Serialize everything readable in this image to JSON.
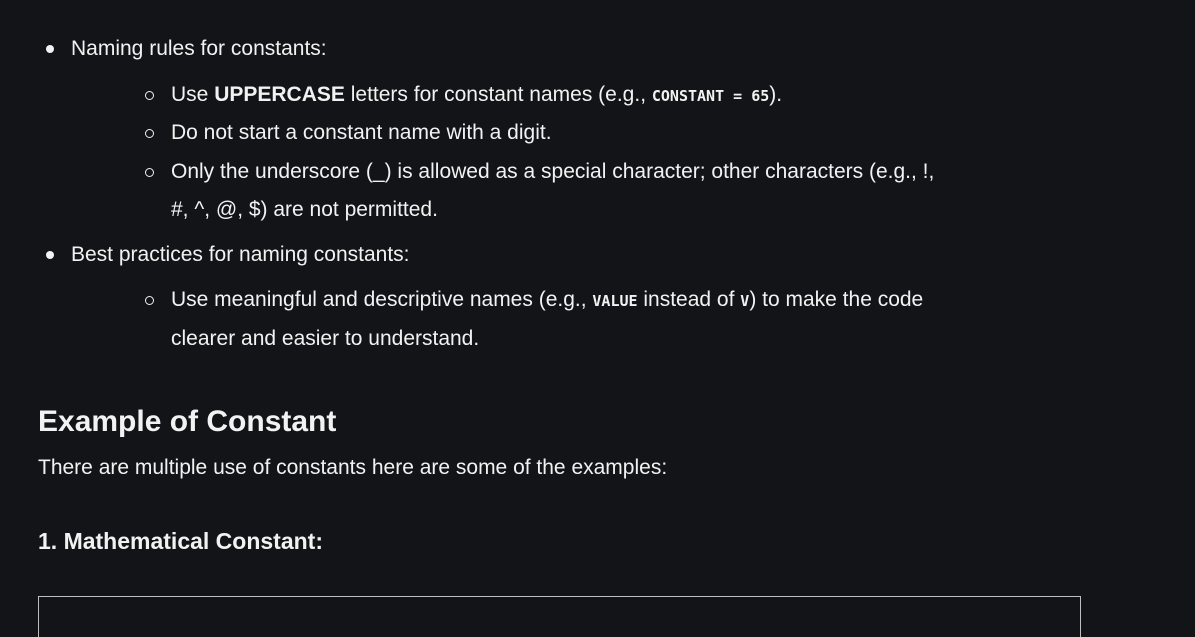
{
  "list": [
    {
      "text": "Naming rules for constants:",
      "items": [
        {
          "pre": "Use ",
          "bold": "UPPERCASE",
          "mid": " letters for constant names (e.g., ",
          "code": "CONSTANT = 65",
          "post": ")."
        },
        {
          "text": "Do not start a constant name with a digit."
        },
        {
          "line1": "Only the underscore (_) is allowed as a special character; other characters (e.g., !,",
          "line2": "#, ^, @, $) are not permitted."
        }
      ]
    },
    {
      "text": "Best practices for naming constants:",
      "items": [
        {
          "pre": "Use meaningful and descriptive names (e.g., ",
          "code1": "VALUE",
          "mid": " instead of ",
          "code2": "V",
          "post": ") to make the code",
          "line2": "clearer and easier to understand."
        }
      ]
    }
  ],
  "section_heading": "Example of Constant",
  "section_intro": "There are multiple use of constants here are some of the examples:",
  "subheading": "1. Mathematical Constant:"
}
